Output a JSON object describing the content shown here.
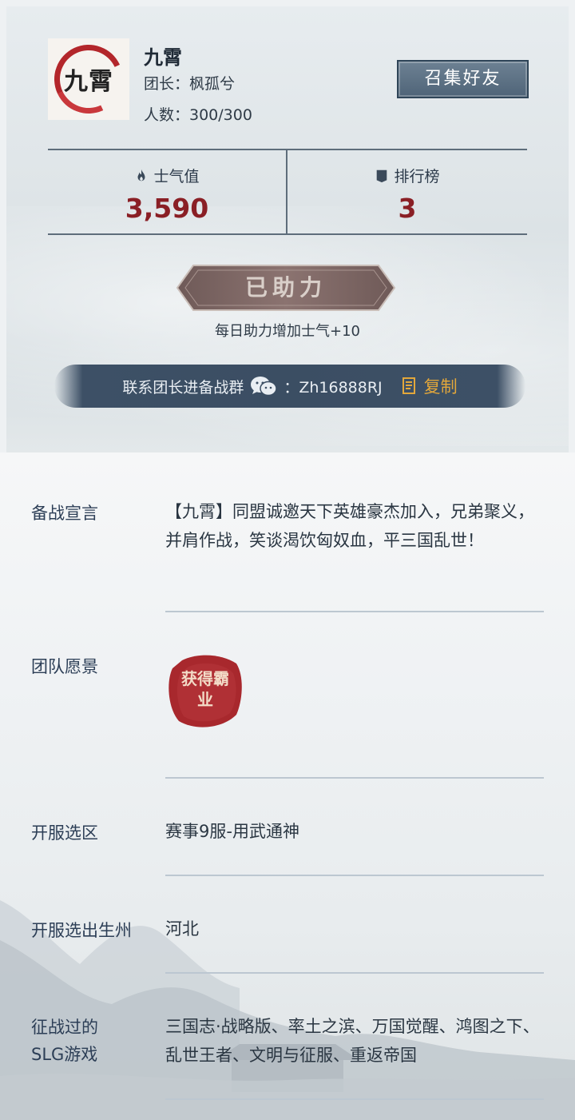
{
  "team": {
    "logo_text": "九霄",
    "name": "九霄",
    "leader": "团长：枫孤兮",
    "count": "人数：300/300",
    "summon_label": "召集好友"
  },
  "stats": {
    "morale_label": "士气值",
    "morale_value": "3,590",
    "rank_label": "排行榜",
    "rank_value": "3"
  },
  "assist": {
    "button_label": "已助力",
    "tip": "每日助力增加士气+10"
  },
  "contact": {
    "text": "联系团长进备战群",
    "wechat_id": "：Zh16888RJ",
    "copy_label": "复制"
  },
  "details": {
    "declaration_label": "备战宣言",
    "declaration_value": "【九霄】同盟诚邀天下英雄豪杰加入，兄弟聚义，并肩作战，笑谈渴饮匈奴血，平三国乱世！",
    "vision_label": "团队愿景",
    "vision_seal": "获得霸业",
    "server_label": "开服选区",
    "server_value": "赛事9服-用武通神",
    "state_label": "开服选出生州",
    "state_value": "河北",
    "games_label_1": "征战过的",
    "games_label_2": "SLG游戏",
    "games_value": "三国志·战略版、率土之滨、万国觉醒、鸿图之下、乱世王者、文明与征服、重返帝国"
  },
  "colors": {
    "accent_red": "#8a1f25",
    "button_blue": "#4f6478",
    "copy_gold": "#e2a73b"
  }
}
